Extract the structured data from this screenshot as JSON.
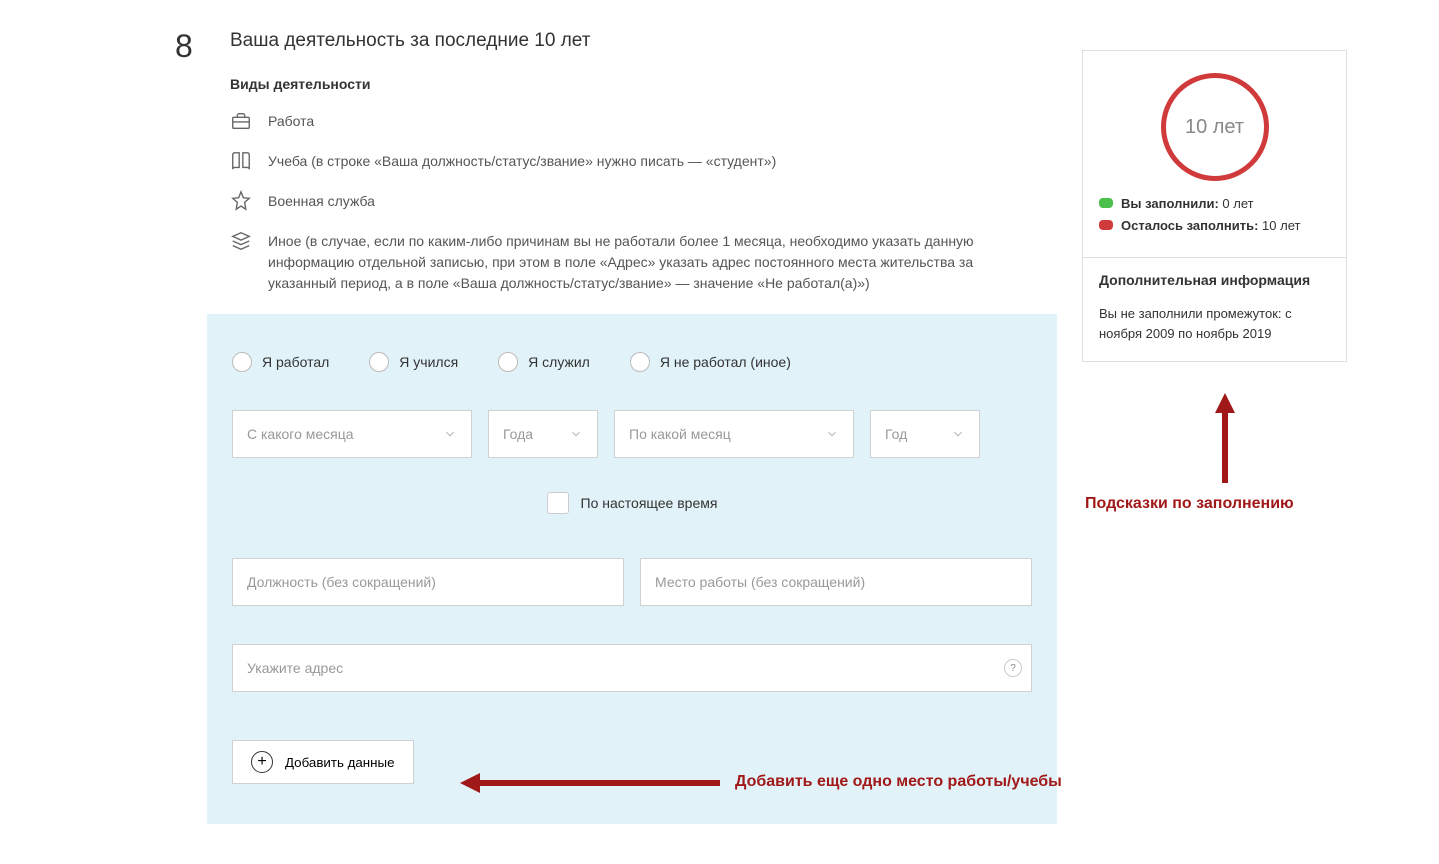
{
  "step_number": "8",
  "title": "Ваша деятельность за последние 10 лет",
  "subtitle": "Виды деятельности",
  "types": {
    "work": "Работа",
    "study": "Учеба (в строке «Ваша должность/статус/звание» нужно писать — «студент»)",
    "military": "Военная служба",
    "other": "Иное (в случае, если по каким-либо причинам вы не работали более 1 месяца, необходимо указать данную информацию отдельной записью, при этом в поле «Адрес» указать адрес постоянного места жительства за указанный период, а в поле «Ваша должность/статус/звание» — значение «Не работал(а)»)"
  },
  "radios": {
    "worked": "Я работал",
    "studied": "Я учился",
    "served": "Я служил",
    "none": "Я не работал (иное)"
  },
  "placeholders": {
    "month_from": "С какого месяца",
    "year_from": "Года",
    "month_to": "По какой месяц",
    "year_to": "Год",
    "present": "По настоящее время",
    "position": "Должность (без сокращений)",
    "place": "Место работы (без сокращений)",
    "address": "Укажите адрес"
  },
  "add_button": "Добавить данные",
  "annotations": {
    "add_more": "Добавить еще одно место работы/учебы",
    "hints": "Подсказки по заполнению"
  },
  "sidebar": {
    "circle_text": "10 лет",
    "filled_label": "Вы заполнили:",
    "filled_value": "0 лет",
    "remain_label": "Осталось заполнить:",
    "remain_value": "10 лет",
    "info_title": "Дополнительная информация",
    "info_text": "Вы не заполнили промежуток: с ноября 2009 по ноябрь 2019"
  },
  "help_q": "?"
}
